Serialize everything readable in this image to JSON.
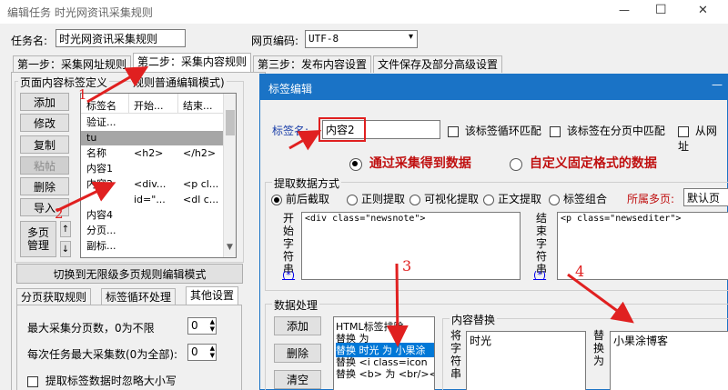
{
  "window": {
    "title": "编辑任务 时光网资讯采集规则",
    "minimize": "—",
    "maximize": "☐",
    "close": "✕"
  },
  "task": {
    "name_label": "任务名:",
    "name_value": "时光网资讯采集规则",
    "encoding_label": "网页编码:",
    "encoding_value": "UTF-8"
  },
  "steps": [
    "第一步：采集网址规则",
    "第二步：采集内容规则",
    "第三步：发布内容设置",
    "文件保存及部分高级设置"
  ],
  "left": {
    "group_label": "页面内容标签定义",
    "group_label2": "规则普通编辑模式)",
    "buttons": [
      "添加",
      "修改",
      "复制",
      "粘帖",
      "删除",
      "导入"
    ],
    "multipage_button": "多页\n管理",
    "up": "↑",
    "down": "↓",
    "columns": [
      "标签名",
      "开始...",
      "结束..."
    ],
    "rows": [
      {
        "name": "验证...",
        "start": "",
        "end": ""
      },
      {
        "name": "tu",
        "start": "",
        "end": ""
      },
      {
        "name": "名称",
        "start": "<h2>",
        "end": "</h2>"
      },
      {
        "name": "内容1",
        "start": "",
        "end": ""
      },
      {
        "name": "内容2",
        "start": "<div...",
        "end": "<p cl..."
      },
      {
        "name": "",
        "start": "id=\"...",
        "end": "<dl c..."
      },
      {
        "name": "内容4",
        "start": "",
        "end": ""
      },
      {
        "name": "分页...",
        "start": "",
        "end": ""
      },
      {
        "name": "副标...",
        "start": "",
        "end": ""
      }
    ],
    "switch_button": "切换到无限级多页规则编辑模式",
    "subtabs": [
      "分页获取规则",
      "标签循环处理",
      "其他设置"
    ],
    "max_pages_label": "最大采集分页数，0为不限",
    "max_pages_value": "0",
    "max_per_task_label": "每次任务最大采集数(0为全部):",
    "max_per_task_value": "0",
    "ignore_size_label": "提取标签数据时忽略大小写"
  },
  "dialog": {
    "title": "标签编辑",
    "tag_name_label": "标签名:",
    "tag_name_value": "内容2",
    "check_loop": "该标签循环匹配",
    "check_multipage": "该标签在分页中匹配",
    "check_from": "从网址",
    "source_by_collect": "通过采集得到数据",
    "source_custom": "自定义固定格式的数据",
    "extract_label": "提取数据方式",
    "extract_modes": [
      "前后截取",
      "正则提取",
      "可视化提取",
      "正文提取",
      "标签组合"
    ],
    "multipage_label": "所属多页:",
    "multipage_value": "默认页",
    "start_label": "开始字符串",
    "start_value": "<div class=\"newsnote\">",
    "end_label": "结束字符串",
    "end_value": "<p class=\"newsediter\">",
    "star": "(*)",
    "processing_label": "数据处理",
    "proc_buttons": [
      "添加",
      "删除",
      "清空"
    ],
    "proc_items": [
      "HTML标签排除",
      "替换 为",
      "替换 时光 为 小果涂",
      "替换 <i class=icon",
      "替换 <b> 为 <br/><"
    ],
    "replace_group": "内容替换",
    "replace_from_label": "将字符串",
    "replace_from_value": "时光",
    "replace_to_label": "替换为",
    "replace_to_value": "小果涂博客"
  },
  "annotations": [
    "1",
    "2",
    "3",
    "4"
  ],
  "colors": {
    "dialog_title_bg": "#1a73c6",
    "highlight_red": "#e02020",
    "selection_blue": "#0078d7"
  }
}
